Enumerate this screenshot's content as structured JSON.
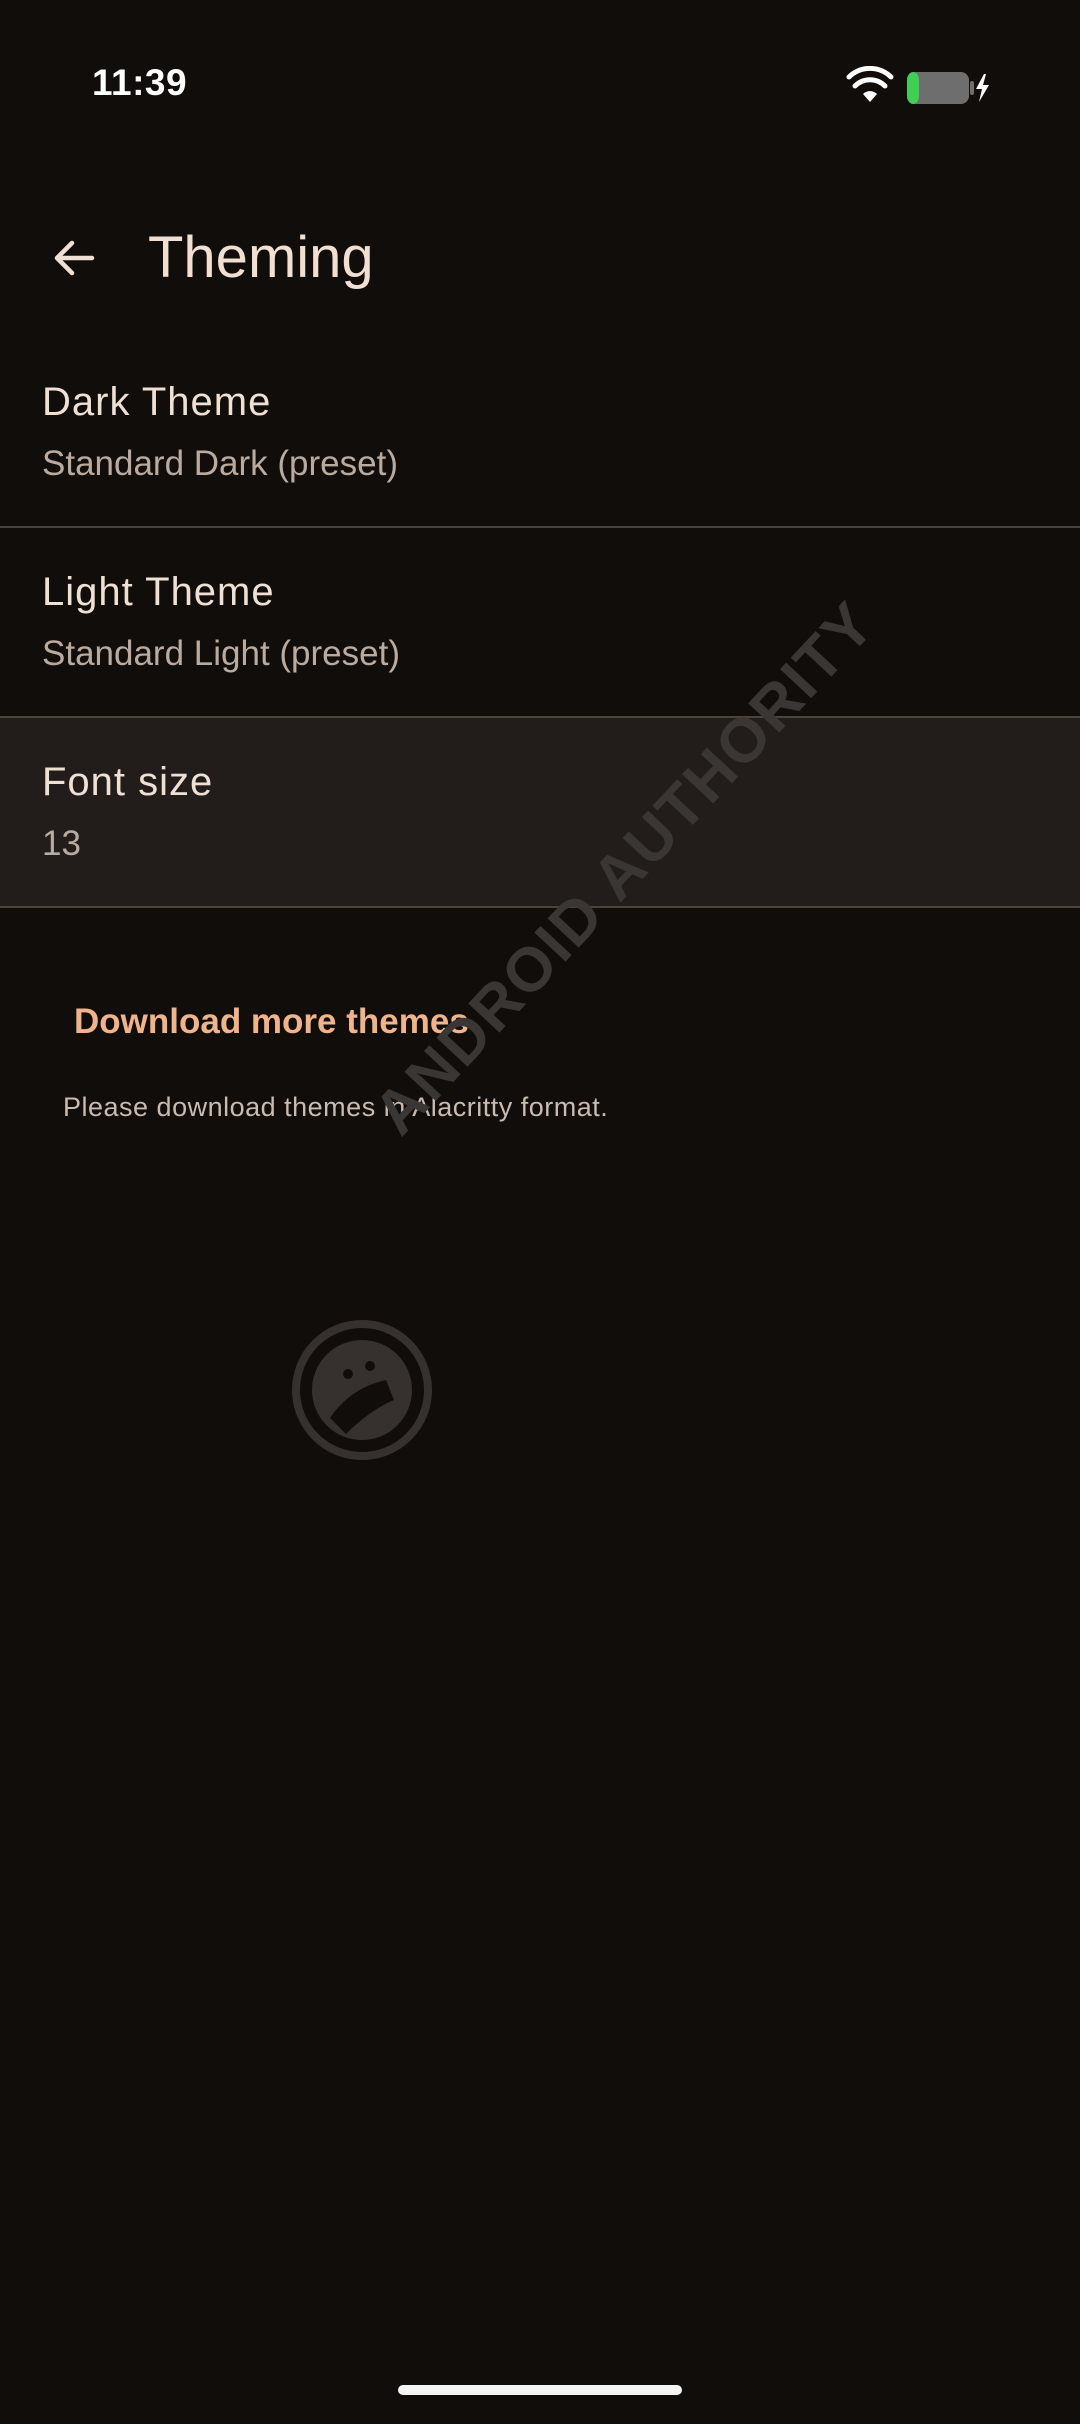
{
  "status_bar": {
    "time": "11:39",
    "wifi_icon": "wifi-icon",
    "battery_icon": "battery-charging-icon",
    "battery_level": 0.2,
    "battery_fill_color": "#3ecf54"
  },
  "app_bar": {
    "back_icon": "arrow-left-icon",
    "title": "Theming"
  },
  "settings": [
    {
      "title": "Dark Theme",
      "value": "Standard Dark (preset)"
    },
    {
      "title": "Light Theme",
      "value": "Standard Light (preset)"
    },
    {
      "title": "Font size",
      "value": "13"
    }
  ],
  "download": {
    "link_label": "Download more themes",
    "note": "Please download themes in Alacritty format."
  },
  "watermark": {
    "text": "ANDROID AUTHORITY",
    "logo_icon": "android-authority-logo"
  },
  "colors": {
    "background": "#110d0a",
    "accent": "#f0b48c",
    "divider": "#4b433c",
    "highlight": "#221d1a"
  }
}
